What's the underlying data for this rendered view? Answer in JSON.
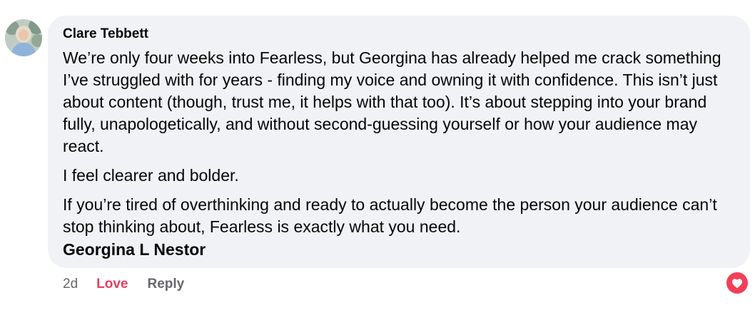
{
  "comment": {
    "author": "Clare Tebbett",
    "avatar_icon": "user-avatar-photo",
    "paragraphs": [
      "We’re only four weeks into Fearless, but Georgina has already helped me crack something I’ve struggled with for years - finding my voice and owning it with confidence. This isn’t just about content (though, trust me, it helps with that too). It’s about stepping into your brand fully, unapologetically, and without second-guessing yourself or how your audience may react.",
      "I feel clearer and bolder.",
      "If you’re tired of overthinking and ready to actually become the person your audience can’t stop thinking about, Fearless is exactly what you need."
    ],
    "mention": "Georgina L Nestor"
  },
  "actions": {
    "timestamp": "2d",
    "love_label": "Love",
    "reply_label": "Reply"
  },
  "reaction": {
    "icon": "heart-reaction-icon",
    "color": "#f33e58"
  },
  "colors": {
    "bubble_bg": "#f0f2f5",
    "text": "#050505",
    "muted": "#65676b",
    "love": "#e4405f"
  }
}
